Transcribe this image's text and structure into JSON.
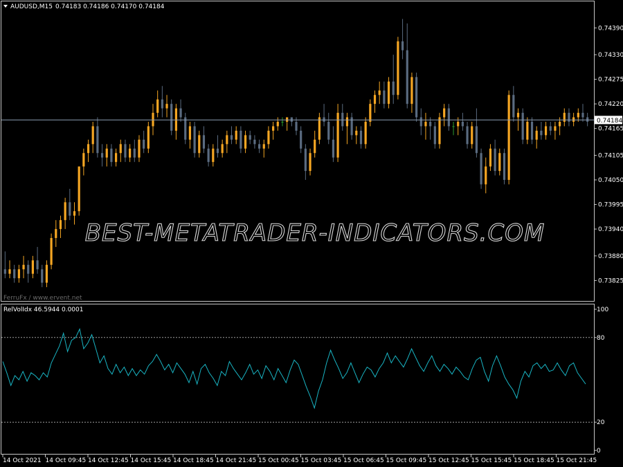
{
  "chart_data": [
    {
      "type": "candlestick",
      "header": {
        "symbol": "AUDUSD,M15",
        "ohlc": "0.74183 0.74186 0.74170 0.74184"
      },
      "current_price_label": "0.74184",
      "current_price": 0.74184,
      "watermark": "BEST-METATRADER-INDICATORS.COM",
      "credit": "FerruFx / www.ervent.net",
      "ylim": [
        0.7379,
        0.7444
      ],
      "y_ticks": [
        "0.74390",
        "0.74330",
        "0.74275",
        "0.74220",
        "0.74165",
        "0.74105",
        "0.74050",
        "0.73995",
        "0.73940",
        "0.73880",
        "0.73825"
      ],
      "colors": {
        "bull": "#f5a623",
        "bear": "#5a6b80",
        "doji": "#2e9e2e",
        "price_line": "#8a9bb0",
        "frame": "#c8c8c8"
      },
      "candles": [
        [
          0.7385,
          0.7389,
          0.7383,
          0.7384
        ],
        [
          0.7384,
          0.7387,
          0.7383,
          0.7385
        ],
        [
          0.7385,
          0.7386,
          0.7382,
          0.7383
        ],
        [
          0.7383,
          0.7386,
          0.7382,
          0.7385
        ],
        [
          0.7385,
          0.7388,
          0.7383,
          0.7386
        ],
        [
          0.7386,
          0.7387,
          0.7382,
          0.7384
        ],
        [
          0.7384,
          0.7388,
          0.7383,
          0.7387
        ],
        [
          0.7387,
          0.739,
          0.7384,
          0.7385
        ],
        [
          0.7385,
          0.7386,
          0.7381,
          0.7382
        ],
        [
          0.7382,
          0.7387,
          0.7381,
          0.7386
        ],
        [
          0.7386,
          0.7393,
          0.7385,
          0.7392
        ],
        [
          0.7392,
          0.7396,
          0.739,
          0.7394
        ],
        [
          0.7394,
          0.7397,
          0.7392,
          0.7396
        ],
        [
          0.7396,
          0.7401,
          0.7394,
          0.74
        ],
        [
          0.74,
          0.7403,
          0.7396,
          0.7397
        ],
        [
          0.7397,
          0.74,
          0.7395,
          0.7398
        ],
        [
          0.7398,
          0.7408,
          0.7397,
          0.7408
        ],
        [
          0.7408,
          0.7412,
          0.7406,
          0.7411
        ],
        [
          0.7411,
          0.7414,
          0.7409,
          0.7413
        ],
        [
          0.7413,
          0.7418,
          0.7411,
          0.7417
        ],
        [
          0.7417,
          0.7419,
          0.741,
          0.7411
        ],
        [
          0.7411,
          0.7413,
          0.7408,
          0.741
        ],
        [
          0.741,
          0.7413,
          0.7408,
          0.7412
        ],
        [
          0.7412,
          0.7413,
          0.7408,
          0.7409
        ],
        [
          0.7409,
          0.7412,
          0.7408,
          0.7411
        ],
        [
          0.7411,
          0.7414,
          0.7409,
          0.7413
        ],
        [
          0.7413,
          0.7414,
          0.7409,
          0.741
        ],
        [
          0.741,
          0.7413,
          0.7409,
          0.7412
        ],
        [
          0.7412,
          0.7414,
          0.7409,
          0.741
        ],
        [
          0.741,
          0.7415,
          0.7409,
          0.7414
        ],
        [
          0.7414,
          0.7416,
          0.7411,
          0.7412
        ],
        [
          0.7412,
          0.7418,
          0.7411,
          0.7417
        ],
        [
          0.7417,
          0.7422,
          0.7415,
          0.742
        ],
        [
          0.742,
          0.7425,
          0.7419,
          0.7423
        ],
        [
          0.7423,
          0.7426,
          0.7419,
          0.7421
        ],
        [
          0.7421,
          0.7424,
          0.7419,
          0.7422
        ],
        [
          0.7422,
          0.7423,
          0.7415,
          0.7416
        ],
        [
          0.7416,
          0.7422,
          0.7414,
          0.7421
        ],
        [
          0.7421,
          0.7423,
          0.7418,
          0.7419
        ],
        [
          0.7419,
          0.742,
          0.7413,
          0.7414
        ],
        [
          0.7414,
          0.7418,
          0.7412,
          0.7417
        ],
        [
          0.7417,
          0.7418,
          0.741,
          0.7411
        ],
        [
          0.7411,
          0.7416,
          0.741,
          0.7415
        ],
        [
          0.7415,
          0.7417,
          0.7411,
          0.7412
        ],
        [
          0.7412,
          0.7413,
          0.7408,
          0.7409
        ],
        [
          0.7409,
          0.7413,
          0.7408,
          0.7412
        ],
        [
          0.7412,
          0.7415,
          0.741,
          0.7411
        ],
        [
          0.7411,
          0.7414,
          0.741,
          0.7413
        ],
        [
          0.7413,
          0.7416,
          0.7411,
          0.7415
        ],
        [
          0.7415,
          0.7417,
          0.7413,
          0.7414
        ],
        [
          0.7414,
          0.7417,
          0.7413,
          0.7416
        ],
        [
          0.7416,
          0.7417,
          0.7411,
          0.7412
        ],
        [
          0.7412,
          0.7416,
          0.7411,
          0.7415
        ],
        [
          0.7415,
          0.7416,
          0.7413,
          0.7414
        ],
        [
          0.7414,
          0.7415,
          0.7412,
          0.7413
        ],
        [
          0.7413,
          0.7414,
          0.7411,
          0.7412
        ],
        [
          0.7412,
          0.7414,
          0.741,
          0.7413
        ],
        [
          0.7413,
          0.7417,
          0.7412,
          0.7416
        ],
        [
          0.7416,
          0.7418,
          0.7414,
          0.7417
        ],
        [
          0.7417,
          0.7419,
          0.7416,
          0.7418
        ],
        [
          0.7418,
          0.7419,
          0.7417,
          0.7418
        ],
        [
          0.7418,
          0.7419,
          0.7416,
          0.7419
        ],
        [
          0.7419,
          0.7419,
          0.7417,
          0.7418
        ],
        [
          0.7418,
          0.7419,
          0.7415,
          0.7416
        ],
        [
          0.7416,
          0.7417,
          0.7411,
          0.7412
        ],
        [
          0.7412,
          0.7413,
          0.7405,
          0.7407
        ],
        [
          0.7407,
          0.7412,
          0.7406,
          0.7411
        ],
        [
          0.7411,
          0.7416,
          0.741,
          0.7414
        ],
        [
          0.7414,
          0.742,
          0.7413,
          0.7419
        ],
        [
          0.7419,
          0.7422,
          0.7417,
          0.7418
        ],
        [
          0.7418,
          0.742,
          0.7413,
          0.7414
        ],
        [
          0.7414,
          0.7417,
          0.7409,
          0.741
        ],
        [
          0.741,
          0.7422,
          0.7409,
          0.742
        ],
        [
          0.742,
          0.7422,
          0.7416,
          0.7417
        ],
        [
          0.7417,
          0.742,
          0.7413,
          0.7419
        ],
        [
          0.7419,
          0.742,
          0.7414,
          0.7415
        ],
        [
          0.7415,
          0.7417,
          0.7413,
          0.7416
        ],
        [
          0.7416,
          0.7417,
          0.7412,
          0.7413
        ],
        [
          0.7413,
          0.7419,
          0.7412,
          0.7418
        ],
        [
          0.7418,
          0.7423,
          0.7417,
          0.7422
        ],
        [
          0.7422,
          0.7425,
          0.742,
          0.7424
        ],
        [
          0.7424,
          0.7427,
          0.7422,
          0.7425
        ],
        [
          0.7425,
          0.7427,
          0.7421,
          0.7422
        ],
        [
          0.7422,
          0.7428,
          0.7421,
          0.7427
        ],
        [
          0.7427,
          0.7433,
          0.7422,
          0.7424
        ],
        [
          0.7424,
          0.7437,
          0.7423,
          0.7436
        ],
        [
          0.7436,
          0.7441,
          0.7432,
          0.7434
        ],
        [
          0.7434,
          0.744,
          0.7421,
          0.7422
        ],
        [
          0.7422,
          0.7429,
          0.742,
          0.7428
        ],
        [
          0.7428,
          0.7429,
          0.7418,
          0.7419
        ],
        [
          0.7419,
          0.7421,
          0.7415,
          0.7417
        ],
        [
          0.7417,
          0.742,
          0.7414,
          0.7418
        ],
        [
          0.7418,
          0.7419,
          0.7414,
          0.7417
        ],
        [
          0.7417,
          0.7418,
          0.7412,
          0.7413
        ],
        [
          0.7413,
          0.742,
          0.7412,
          0.7419
        ],
        [
          0.7419,
          0.7422,
          0.7417,
          0.7421
        ],
        [
          0.7421,
          0.7422,
          0.7416,
          0.7417
        ],
        [
          0.7417,
          0.7418,
          0.7415,
          0.7417
        ],
        [
          0.7417,
          0.7419,
          0.7415,
          0.7418
        ],
        [
          0.7418,
          0.742,
          0.7416,
          0.7417
        ],
        [
          0.7417,
          0.7418,
          0.7412,
          0.7413
        ],
        [
          0.7413,
          0.7418,
          0.7412,
          0.7417
        ],
        [
          0.7417,
          0.7421,
          0.741,
          0.7411
        ],
        [
          0.7411,
          0.7412,
          0.7403,
          0.7404
        ],
        [
          0.7404,
          0.741,
          0.7402,
          0.7408
        ],
        [
          0.7408,
          0.7413,
          0.7407,
          0.7412
        ],
        [
          0.7412,
          0.7414,
          0.7406,
          0.7407
        ],
        [
          0.7407,
          0.7412,
          0.7406,
          0.7411
        ],
        [
          0.7411,
          0.7412,
          0.7404,
          0.7405
        ],
        [
          0.7405,
          0.7425,
          0.7404,
          0.7424
        ],
        [
          0.7424,
          0.7426,
          0.7418,
          0.7419
        ],
        [
          0.7419,
          0.7421,
          0.7416,
          0.742
        ],
        [
          0.742,
          0.7421,
          0.7413,
          0.7414
        ],
        [
          0.7414,
          0.7419,
          0.7413,
          0.7418
        ],
        [
          0.7418,
          0.7419,
          0.7413,
          0.7414
        ],
        [
          0.7414,
          0.7417,
          0.7412,
          0.7416
        ],
        [
          0.7416,
          0.7418,
          0.7414,
          0.7415
        ],
        [
          0.7415,
          0.7418,
          0.7414,
          0.7417
        ],
        [
          0.7417,
          0.7418,
          0.7415,
          0.7416
        ],
        [
          0.7416,
          0.7418,
          0.7414,
          0.7417
        ],
        [
          0.7417,
          0.7419,
          0.7415,
          0.7418
        ],
        [
          0.7418,
          0.7421,
          0.7417,
          0.742
        ],
        [
          0.742,
          0.7421,
          0.7417,
          0.7418
        ],
        [
          0.7418,
          0.742,
          0.7417,
          0.7419
        ],
        [
          0.7419,
          0.7421,
          0.7418,
          0.742
        ],
        [
          0.742,
          0.7422,
          0.7418,
          0.7419
        ],
        [
          0.7419,
          0.742,
          0.7417,
          0.7418
        ]
      ]
    },
    {
      "type": "line",
      "title": "RelVolIdx 46.5944 0.0001",
      "ylim": [
        0,
        100
      ],
      "y_ticks": [
        "100",
        "80",
        "20",
        "0"
      ],
      "levels": [
        80,
        20
      ],
      "line_color": "#19b5c4",
      "x_labels": [
        "14 Oct 2021",
        "14 Oct 09:45",
        "14 Oct 12:45",
        "14 Oct 15:45",
        "14 Oct 18:45",
        "14 Oct 21:45",
        "15 Oct 00:45",
        "15 Oct 03:45",
        "15 Oct 06:45",
        "15 Oct 09:45",
        "15 Oct 12:45",
        "15 Oct 15:45",
        "15 Oct 18:45",
        "15 Oct 21:45"
      ],
      "values": [
        63,
        55,
        46,
        53,
        50,
        56,
        49,
        55,
        53,
        50,
        55,
        52,
        62,
        68,
        74,
        83,
        70,
        78,
        80,
        86,
        72,
        76,
        82,
        72,
        62,
        67,
        58,
        54,
        61,
        55,
        59,
        53,
        58,
        53,
        57,
        54,
        60,
        63,
        68,
        63,
        57,
        61,
        55,
        62,
        58,
        54,
        48,
        56,
        47,
        58,
        61,
        55,
        51,
        46,
        56,
        53,
        63,
        58,
        54,
        50,
        55,
        61,
        54,
        57,
        51,
        60,
        56,
        50,
        58,
        53,
        48,
        57,
        64,
        61,
        53,
        45,
        38,
        30,
        42,
        50,
        62,
        71,
        64,
        58,
        51,
        55,
        62,
        55,
        48,
        54,
        59,
        57,
        52,
        58,
        62,
        69,
        62,
        67,
        63,
        59,
        65,
        72,
        66,
        60,
        56,
        62,
        67,
        60,
        56,
        61,
        58,
        54,
        59,
        56,
        52,
        50,
        58,
        64,
        66,
        56,
        49,
        60,
        67,
        60,
        52,
        47,
        43,
        37,
        49,
        56,
        52,
        60,
        62,
        58,
        61,
        56,
        57,
        62,
        57,
        53,
        60,
        62,
        55,
        51,
        47
      ]
    }
  ]
}
